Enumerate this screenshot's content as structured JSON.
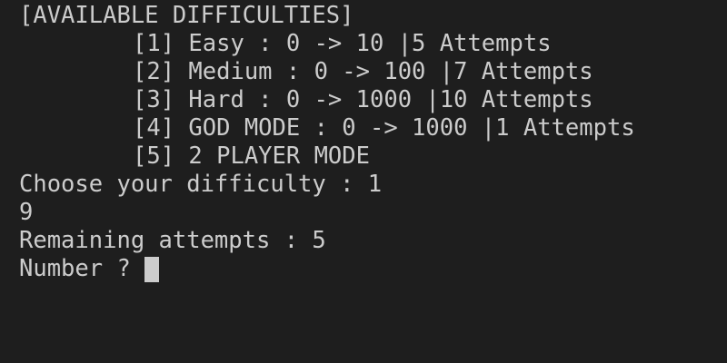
{
  "terminal": {
    "header": "[AVAILABLE DIFFICULTIES]",
    "difficulties": [
      "[1] Easy : 0 -> 10 |5 Attempts",
      "[2] Medium : 0 -> 100 |7 Attempts",
      "[3] Hard : 0 -> 1000 |10 Attempts",
      "[4] GOD MODE : 0 -> 1000 |1 Attempts",
      "[5] 2 PLAYER MODE"
    ],
    "choose_prompt": "Choose your difficulty : 1",
    "user_input": "9",
    "remaining_attempts": "Remaining attempts : 5",
    "number_prompt": "Number ? ",
    "colors": {
      "background": "#1e1e1e",
      "text": "#cccccc",
      "cursor": "#cccccc",
      "accent_yellow": "#e5e510"
    }
  }
}
